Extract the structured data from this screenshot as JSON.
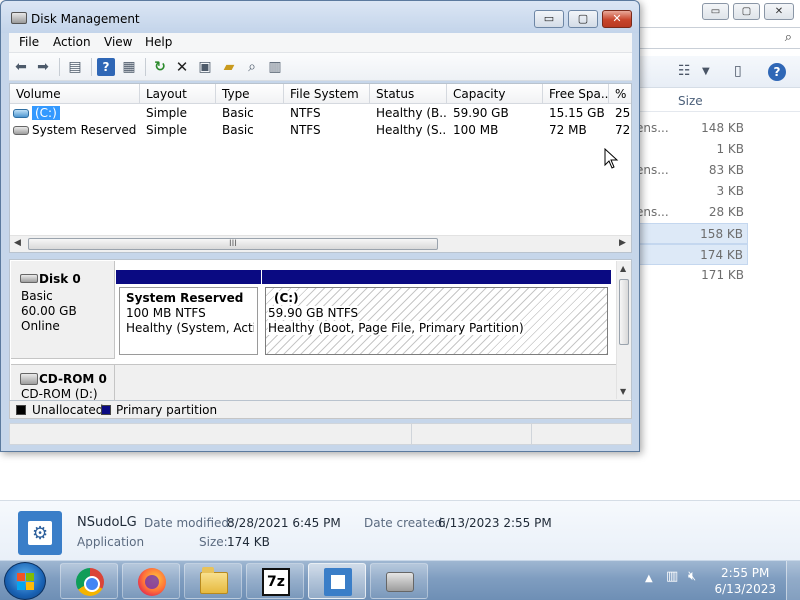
{
  "disk_mgmt": {
    "title": "Disk Management",
    "window_buttons": {
      "minimize": "▭",
      "maximize": "▢",
      "close": "✕"
    },
    "menus": [
      "File",
      "Action",
      "View",
      "Help"
    ],
    "toolbar_icons": [
      "back-arrow-icon",
      "forward-arrow-icon",
      "console-tree-icon",
      "help-icon",
      "properties-icon",
      "refresh-icon",
      "delete-icon",
      "settings-icon",
      "open-folder-icon",
      "search-icon",
      "properties-list-icon"
    ],
    "columns": [
      "Volume",
      "Layout",
      "Type",
      "File System",
      "Status",
      "Capacity",
      "Free Spa...",
      "% F"
    ],
    "volumes": [
      {
        "volume": "(C:)",
        "layout": "Simple",
        "type": "Basic",
        "fs": "NTFS",
        "status": "Healthy (B...",
        "capacity": "59.90 GB",
        "free": "15.15 GB",
        "pct": "25"
      },
      {
        "volume": "System Reserved",
        "layout": "Simple",
        "type": "Basic",
        "fs": "NTFS",
        "status": "Healthy (S...",
        "capacity": "100 MB",
        "free": "72 MB",
        "pct": "72"
      }
    ],
    "scroll_grip": "III",
    "disk0": {
      "name": "Disk 0",
      "type": "Basic",
      "size": "60.00 GB",
      "state": "Online",
      "partitions": [
        {
          "name": "System Reserved",
          "detail": "100 MB NTFS",
          "status": "Healthy (System, Active,"
        },
        {
          "name": "(C:)",
          "detail": "59.90 GB NTFS",
          "status": "Healthy (Boot, Page File, Primary Partition)"
        }
      ]
    },
    "cdrom": {
      "name": "CD-ROM 0",
      "drive": "CD-ROM (D:)"
    },
    "legend": [
      {
        "label": "Unallocated",
        "color": "#000000"
      },
      {
        "label": "Primary partition",
        "color": "#0a0a82"
      }
    ]
  },
  "explorer_bg": {
    "size_header": "Size",
    "rows": [
      {
        "frag": "ens...",
        "size": "148 KB",
        "selected": false
      },
      {
        "frag": "",
        "size": "1 KB",
        "selected": false
      },
      {
        "frag": "ens...",
        "size": "83 KB",
        "selected": false
      },
      {
        "frag": "",
        "size": "3 KB",
        "selected": false
      },
      {
        "frag": "ens...",
        "size": "28 KB",
        "selected": false
      },
      {
        "frag": "",
        "size": "158 KB",
        "selected": true
      },
      {
        "frag": "",
        "size": "174 KB",
        "selected": true
      },
      {
        "frag": "",
        "size": "171 KB",
        "selected": false
      }
    ],
    "details": {
      "name": "NSudoLG",
      "type": "Application",
      "modified_label": "Date modified:",
      "modified": "8/28/2021 6:45 PM",
      "created_label": "Date created:",
      "created": "6/13/2023 2:55 PM",
      "size_label": "Size:",
      "size": "174 KB"
    }
  },
  "taskbar": {
    "apps": [
      "chrome-icon",
      "firefox-icon",
      "folder-icon",
      "7zip-icon",
      "disk-management-icon",
      "drive-icon"
    ],
    "sevenzip_text": "7z",
    "tray_arrow": "▲",
    "clock_time": "2:55 PM",
    "clock_date": "6/13/2023"
  }
}
